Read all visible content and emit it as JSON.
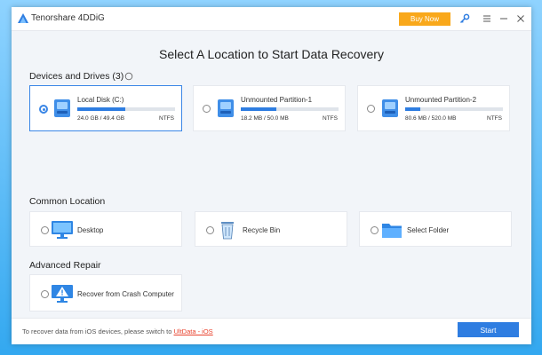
{
  "app": {
    "title": "Tenorshare 4DDiG"
  },
  "titlebar": {
    "buy_now": "Buy Now",
    "icons": [
      "key-icon",
      "menu-icon",
      "minimize-icon",
      "close-icon"
    ]
  },
  "main": {
    "title": "Select A Location to Start Data Recovery"
  },
  "devices": {
    "label": "Devices and Drives (3)",
    "drives": [
      {
        "name": "Local Disk (C:)",
        "size": "24.0 GB / 49.4 GB",
        "fs": "NTFS",
        "used_percent": 49,
        "selected": true
      },
      {
        "name": "Unmounted Partition-1",
        "size": "18.2 MB / 50.0 MB",
        "fs": "NTFS",
        "used_percent": 36,
        "selected": false
      },
      {
        "name": "Unmounted Partition-2",
        "size": "80.6 MB / 520.0 MB",
        "fs": "NTFS",
        "used_percent": 15,
        "selected": false
      }
    ]
  },
  "common": {
    "label": "Common Location",
    "items": [
      {
        "label": "Desktop",
        "icon": "desktop-icon"
      },
      {
        "label": "Recycle Bin",
        "icon": "recycle-bin-icon"
      },
      {
        "label": "Select Folder",
        "icon": "folder-icon"
      }
    ]
  },
  "repair": {
    "label": "Advanced Repair",
    "item": {
      "label": "Recover from Crash Computer",
      "icon": "crash-computer-icon"
    }
  },
  "footer": {
    "text": "To recover data from iOS devices, please switch to ",
    "link": "UltData - iOS",
    "start": "Start"
  },
  "colors": {
    "accent": "#2e7de1",
    "buy_now": "#f9a81b",
    "link": "#e8412c"
  }
}
